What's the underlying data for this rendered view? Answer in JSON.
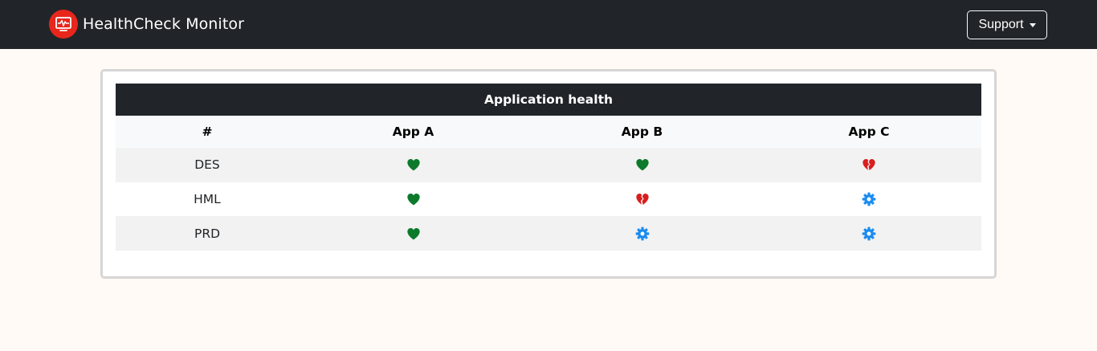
{
  "navbar": {
    "brand": "HealthCheck Monitor",
    "logo_icon": "heart-monitor-icon",
    "support_label": "Support"
  },
  "table": {
    "caption": "Application health",
    "columns": [
      "#",
      "App A",
      "App B",
      "App C"
    ],
    "rows": [
      {
        "env": "DES",
        "cells": [
          "healthy",
          "healthy",
          "broken"
        ]
      },
      {
        "env": "HML",
        "cells": [
          "healthy",
          "broken",
          "maintenance"
        ]
      },
      {
        "env": "PRD",
        "cells": [
          "healthy",
          "maintenance",
          "maintenance"
        ]
      }
    ]
  },
  "status_icons": {
    "healthy": {
      "icon": "heart-icon",
      "color": "#0c7a2a"
    },
    "broken": {
      "icon": "broken-heart-icon",
      "color": "#d81e1e"
    },
    "maintenance": {
      "icon": "gear-icon",
      "color": "#1a8cf0"
    }
  },
  "colors": {
    "navbar_bg": "#212529",
    "page_bg": "#fffaf5",
    "logo_bg": "#e8261c"
  }
}
